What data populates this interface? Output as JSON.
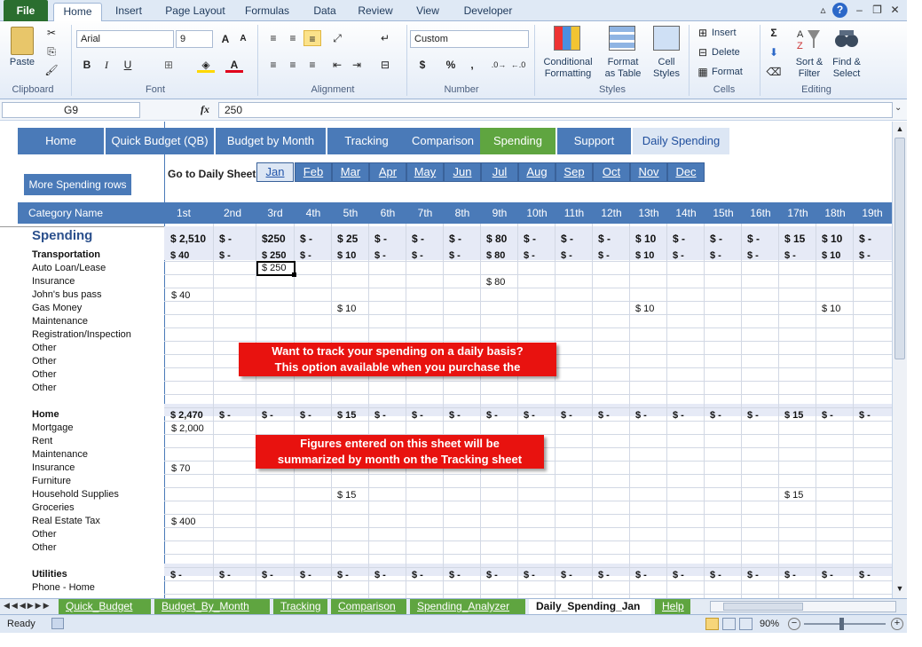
{
  "ribbon_tabs": [
    "File",
    "Home",
    "Insert",
    "Page Layout",
    "Formulas",
    "Data",
    "Review",
    "View",
    "Developer"
  ],
  "ribbon": {
    "clipboard": {
      "paste": "Paste",
      "label": "Clipboard"
    },
    "font": {
      "name": "Arial",
      "size": "9",
      "bold": "B",
      "italic": "I",
      "underline": "U",
      "label": "Font"
    },
    "alignment": {
      "label": "Alignment"
    },
    "number": {
      "format": "Custom",
      "currency": "$",
      "percent": "%",
      "comma": ",",
      "label": "Number"
    },
    "styles": {
      "conditional_1": "Conditional",
      "conditional_2": "Formatting",
      "format_1": "Format",
      "format_2": "as Table",
      "cell_1": "Cell",
      "cell_2": "Styles",
      "label": "Styles"
    },
    "cells": {
      "insert": "Insert",
      "delete": "Delete",
      "format": "Format",
      "label": "Cells"
    },
    "editing": {
      "sum": "Σ",
      "sort_1": "Sort &",
      "sort_2": "Filter",
      "find_1": "Find &",
      "find_2": "Select",
      "label": "Editing"
    }
  },
  "formula_bar": {
    "name_box": "G9",
    "fx": "fx",
    "value": "250"
  },
  "nav": [
    "Home",
    "Quick Budget (QB)",
    "Budget by Month",
    "Tracking",
    "Comparison",
    "Spending",
    "Support",
    "Daily Spending"
  ],
  "more_rows_button": "More Spending rows",
  "go_to_label": "Go to Daily Sheet:",
  "months": [
    "Jan",
    "Feb",
    "Mar",
    "Apr",
    "May",
    "Jun",
    "Jul",
    "Aug",
    "Sep",
    "Oct",
    "Nov",
    "Dec"
  ],
  "header": {
    "category": "Category Name",
    "days": [
      "1st",
      "2nd",
      "3rd",
      "4th",
      "5th",
      "6th",
      "7th",
      "8th",
      "9th",
      "10th",
      "11th",
      "12th",
      "13th",
      "14th",
      "15th",
      "16th",
      "17th",
      "18th",
      "19th"
    ]
  },
  "spending": {
    "title": "Spending",
    "row": [
      "$ 2,510",
      "$ -",
      "$250",
      "$ -",
      "$ 25",
      "$ -",
      "$ -",
      "$ -",
      "$ 80",
      "$ -",
      "$ -",
      "$ -",
      "$ 10",
      "$ -",
      "$ -",
      "$ -",
      "$ 15",
      "$ 10",
      "$ -"
    ]
  },
  "transportation": {
    "title": "Transportation",
    "row": [
      "$     40",
      "$ -",
      "$ 250",
      "$ -",
      "$ 10",
      "$ -",
      "$ -",
      "$ -",
      "$ 80",
      "$ -",
      "$ -",
      "$ -",
      "$ 10",
      "$ -",
      "$ -",
      "$ -",
      "$ -",
      "$ 10",
      "$ -"
    ],
    "items": [
      "Auto Loan/Lease",
      "Insurance",
      "John's bus pass",
      "Gas Money",
      "Maintenance",
      "Registration/Inspection",
      "Other",
      "Other",
      "Other",
      "Other"
    ]
  },
  "home": {
    "title": "Home",
    "row": [
      "$  2,470",
      "$ -",
      "$ -",
      "$ -",
      "$ 15",
      "$ -",
      "$ -",
      "$ -",
      "$ -",
      "$ -",
      "$ -",
      "$ -",
      "$ -",
      "$ -",
      "$ -",
      "$ -",
      "$ 15",
      "$ -",
      "$ -"
    ],
    "items": [
      "Mortgage",
      "Rent",
      "Maintenance",
      "Insurance",
      "Furniture",
      "Household Supplies",
      "Groceries",
      "Real Estate Tax",
      "Other",
      "Other"
    ]
  },
  "utilities": {
    "title": "Utilities",
    "row": [
      "$ -",
      "$ -",
      "$ -",
      "$ -",
      "$ -",
      "$ -",
      "$ -",
      "$ -",
      "$ -",
      "$ -",
      "$ -",
      "$ -",
      "$ -",
      "$ -",
      "$ -",
      "$ -",
      "$ -",
      "$ -",
      "$ -"
    ],
    "items": [
      "Phone - Home"
    ]
  },
  "entries": {
    "auto_loan_3rd": "$ 250",
    "insurance_9th": "$   80",
    "bus_pass_1st": "$      40",
    "gas_5th": "$   10",
    "gas_13th": "$   10",
    "gas_18th": "$   10",
    "mortgage_1st": "$  2,000",
    "home_ins_1st": "$      70",
    "household_5th": "$   15",
    "household_17th": "$   15",
    "tax_1st": "$     400"
  },
  "callouts": {
    "one_l1": "Want to track your spending on a daily basis?",
    "one_l2": "This option available when you purchase the",
    "two_l1": "Figures entered on this sheet will be",
    "two_l2": "summarized by month on the Tracking sheet"
  },
  "sheet_tabs": [
    "Quick_Budget",
    "Budget_By_Month",
    "Tracking",
    "Comparison",
    "Spending_Analyzer",
    "Daily_Spending_Jan",
    "Help"
  ],
  "status": {
    "ready": "Ready",
    "zoom": "90%"
  },
  "colors": {
    "nav_blue": "#4a7ab8",
    "nav_green": "#5fa540",
    "callout_red": "#e8120f",
    "file_green": "#2a6e2f"
  }
}
